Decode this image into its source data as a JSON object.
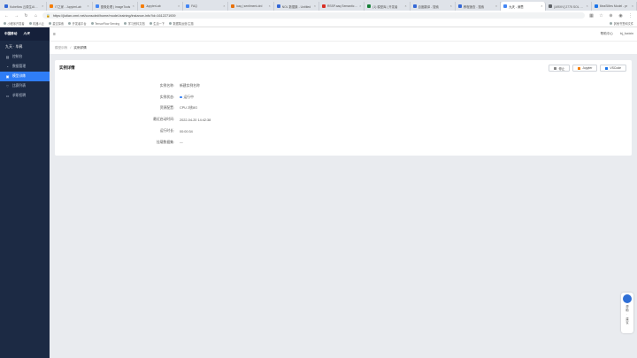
{
  "browser": {
    "tabs": [
      {
        "title": "Kubeflow 云原生AI平台",
        "color": "#3367d6",
        "active": false
      },
      {
        "title": "IT之家 - JupyterLab",
        "color": "#f57c00",
        "active": false
      },
      {
        "title": "图像处理 | ImageTools",
        "color": "#4285f4",
        "active": false
      },
      {
        "title": "JupyterLab",
        "color": "#f57c00",
        "active": false
      },
      {
        "title": "FAQ",
        "color": "#4285f4",
        "active": false
      },
      {
        "title": "kaq | sentiment-drd",
        "color": "#e8710a",
        "active": false
      },
      {
        "title": "NOL 数据集 - Untitled",
        "color": "#3367d6",
        "active": false
      },
      {
        "title": "RSSP.aaq Semantic En",
        "color": "#d93025",
        "active": false
      },
      {
        "title": "(1) 模型库 | 开发者",
        "color": "#188038",
        "active": false
      },
      {
        "title": "百度翻译 - 搜索",
        "color": "#3367d6",
        "active": false
      },
      {
        "title": "教程速查 - 搜索",
        "color": "#3367d6",
        "active": false
      },
      {
        "title": "九天 - 深思",
        "color": "#4285f4",
        "active": true
      },
      {
        "title": "[ARXIV] 2775 SOL 面向",
        "color": "#5f6368",
        "active": false
      },
      {
        "title": "MeaSMes Model - pr",
        "color": "#1a73e8",
        "active": false
      }
    ],
    "url": "https://jiutian.cmri.net/console#/home/model-training/instance-info?id=1612271939",
    "bookmarks": [
      "小程序开发者",
      "机器人云",
      "星空探索",
      "开发者平台",
      "TensorFlow Serving",
      "学习资料文档",
      "生活一下",
      "数据集运营/主题"
    ],
    "bookmark_right": "其他书签和文件"
  },
  "sidebar": {
    "logo": "中国移动",
    "logo_sub": "China Mobile",
    "brand_text": "九天",
    "user": "九天 · 毕昇",
    "items": [
      {
        "label": "控制台",
        "icon": "▤"
      },
      {
        "label": "数据管理",
        "icon": "◔"
      },
      {
        "label": "模型训练",
        "icon": "▣",
        "active": true
      },
      {
        "label": "比赛列表",
        "icon": "♡"
      },
      {
        "label": "求职招聘",
        "icon": "▭"
      }
    ]
  },
  "topbar": {
    "menu_icon": "≡",
    "links": [
      "帮助中心",
      "bj_fuxixin"
    ]
  },
  "breadcrumb": [
    "模型训练",
    "实例详情"
  ],
  "card": {
    "title": "实例详情",
    "buttons": [
      {
        "label": "停止",
        "color": "#888888"
      },
      {
        "label": "Jupyter",
        "color": "#f57c00"
      },
      {
        "label": "VSCode",
        "color": "#1a73e8"
      }
    ],
    "fields": [
      {
        "label": "实例名称:",
        "value": "新建实例名称",
        "dot": false
      },
      {
        "label": "实例状态:",
        "value": "运行中",
        "dot": true
      },
      {
        "label": "资源配置:",
        "value": "CPU 2核8G",
        "dot": false
      },
      {
        "label": "最近启动时间:",
        "value": "2022-04-20 14:42:38",
        "dot": false
      },
      {
        "label": "运行时长:",
        "value": "00:00:34",
        "dot": false
      },
      {
        "label": "挂载数据集:",
        "value": "—",
        "dot": false
      }
    ]
  },
  "help_widget": {
    "label": "帮助 · 建议"
  }
}
